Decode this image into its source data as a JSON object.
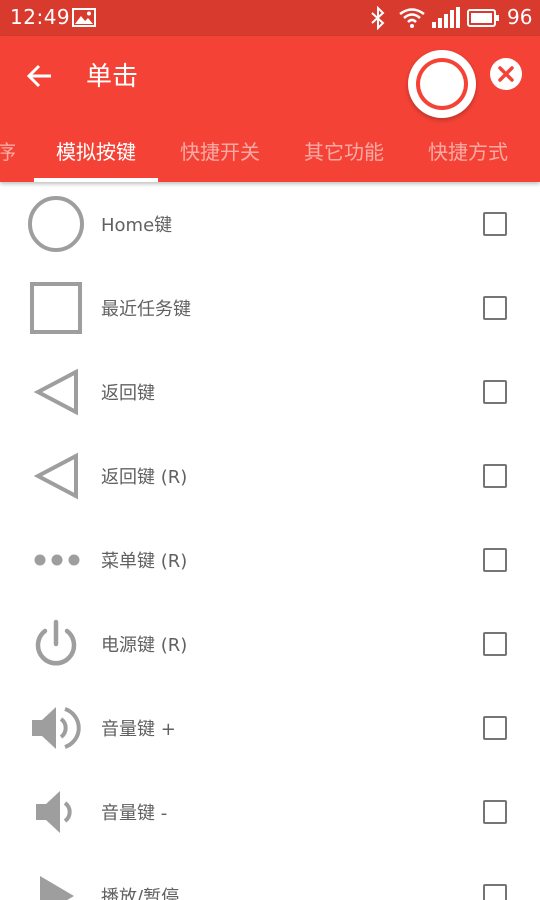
{
  "status_bar": {
    "time": "12:49",
    "battery_level": "96"
  },
  "app_bar": {
    "title": "单击"
  },
  "tabs": [
    {
      "label": "序"
    },
    {
      "label": "模拟按键"
    },
    {
      "label": "快捷开关"
    },
    {
      "label": "其它功能"
    },
    {
      "label": "快捷方式"
    }
  ],
  "list": {
    "items": [
      {
        "label": "Home键",
        "icon": "circle-icon",
        "checked": false
      },
      {
        "label": "最近任务键",
        "icon": "square-icon",
        "checked": false
      },
      {
        "label": "返回键",
        "icon": "triangle-back-icon",
        "checked": false
      },
      {
        "label": "返回键 (R)",
        "icon": "triangle-back-icon",
        "checked": false
      },
      {
        "label": "菜单键 (R)",
        "icon": "three-dots-icon",
        "checked": false
      },
      {
        "label": "电源键 (R)",
        "icon": "power-icon",
        "checked": false
      },
      {
        "label": "音量键 +",
        "icon": "volume-up-icon",
        "checked": false
      },
      {
        "label": "音量键 -",
        "icon": "volume-down-icon",
        "checked": false
      },
      {
        "label": "播放/暂停",
        "icon": "play-icon",
        "checked": false
      }
    ]
  },
  "colors": {
    "status_bar": "#d83a2e",
    "app_bar": "#f44336",
    "icon_gray": "#9e9e9e",
    "label_gray": "#616161"
  }
}
